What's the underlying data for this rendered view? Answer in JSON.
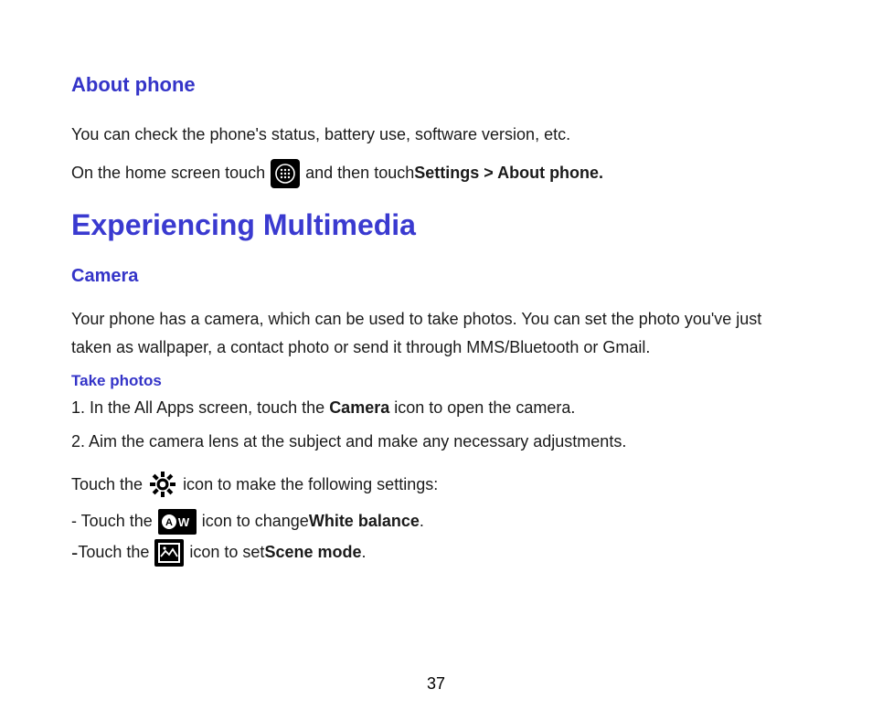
{
  "about": {
    "heading": "About phone",
    "desc": "You can check the phone's status, battery use, software version, etc.",
    "instr_pre": "On the home screen touch",
    "instr_post_a": "and then touch ",
    "instr_post_b": "Settings > About phone."
  },
  "chapter": {
    "heading": "Experiencing Multimedia"
  },
  "camera": {
    "heading": "Camera",
    "desc": "Your phone has a camera, which can be used to take photos. You can set the photo you've just taken as wallpaper, a contact photo or send it through MMS/Bluetooth or Gmail.",
    "take_photos_heading": "Take photos",
    "step1_a": "1. In the All Apps screen, touch the ",
    "step1_b": "Camera",
    "step1_c": " icon to open the camera.",
    "step2": "2. Aim the camera lens at the subject and make any necessary adjustments.",
    "settings_pre": "Touch the",
    "settings_post": "icon to make the following settings:",
    "wb_pre": "- Touch the",
    "wb_mid": "icon to change ",
    "wb_bold": "White balance",
    "wb_end": ".",
    "scene_dash": "-",
    "scene_pre": " Touch the",
    "scene_mid": "icon to set ",
    "scene_bold": "Scene mode",
    "scene_end": "."
  },
  "pageNumber": "37"
}
